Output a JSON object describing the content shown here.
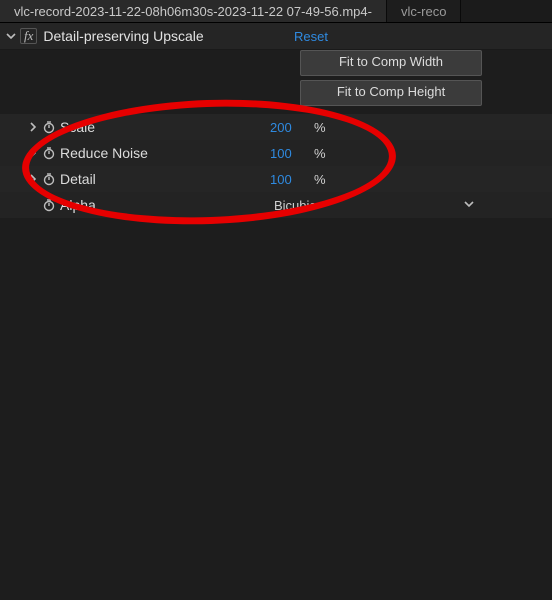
{
  "tabs": {
    "active": "vlc-record-2023-11-22-08h06m30s-2023-11-22 07-49-56.mp4-",
    "inactive": "vlc-reco"
  },
  "effect": {
    "name": "Detail-preserving Upscale",
    "reset": "Reset",
    "fit_width": "Fit to Comp Width",
    "fit_height": "Fit to Comp Height"
  },
  "params": {
    "scale": {
      "label": "Scale",
      "value": "200",
      "unit": "%"
    },
    "reduce_noise": {
      "label": "Reduce Noise",
      "value": "100",
      "unit": "%"
    },
    "detail": {
      "label": "Detail",
      "value": "100",
      "unit": "%"
    },
    "alpha": {
      "label": "Alpha",
      "value": "Bicubic"
    }
  }
}
